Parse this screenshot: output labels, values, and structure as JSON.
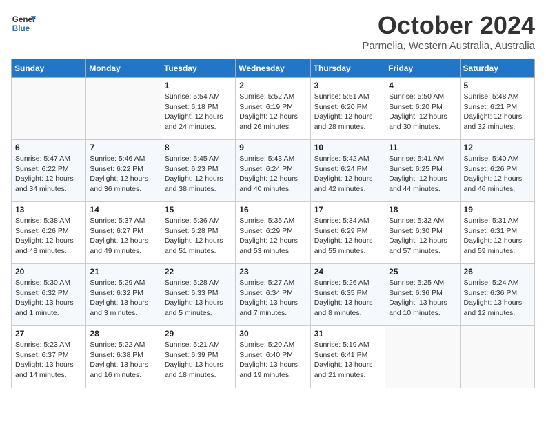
{
  "logo": {
    "line1": "General",
    "line2": "Blue"
  },
  "title": "October 2024",
  "subtitle": "Parmelia, Western Australia, Australia",
  "headers": [
    "Sunday",
    "Monday",
    "Tuesday",
    "Wednesday",
    "Thursday",
    "Friday",
    "Saturday"
  ],
  "weeks": [
    [
      {
        "day": "",
        "info": ""
      },
      {
        "day": "",
        "info": ""
      },
      {
        "day": "1",
        "info": "Sunrise: 5:54 AM\nSunset: 6:18 PM\nDaylight: 12 hours\nand 24 minutes."
      },
      {
        "day": "2",
        "info": "Sunrise: 5:52 AM\nSunset: 6:19 PM\nDaylight: 12 hours\nand 26 minutes."
      },
      {
        "day": "3",
        "info": "Sunrise: 5:51 AM\nSunset: 6:20 PM\nDaylight: 12 hours\nand 28 minutes."
      },
      {
        "day": "4",
        "info": "Sunrise: 5:50 AM\nSunset: 6:20 PM\nDaylight: 12 hours\nand 30 minutes."
      },
      {
        "day": "5",
        "info": "Sunrise: 5:48 AM\nSunset: 6:21 PM\nDaylight: 12 hours\nand 32 minutes."
      }
    ],
    [
      {
        "day": "6",
        "info": "Sunrise: 5:47 AM\nSunset: 6:22 PM\nDaylight: 12 hours\nand 34 minutes."
      },
      {
        "day": "7",
        "info": "Sunrise: 5:46 AM\nSunset: 6:22 PM\nDaylight: 12 hours\nand 36 minutes."
      },
      {
        "day": "8",
        "info": "Sunrise: 5:45 AM\nSunset: 6:23 PM\nDaylight: 12 hours\nand 38 minutes."
      },
      {
        "day": "9",
        "info": "Sunrise: 5:43 AM\nSunset: 6:24 PM\nDaylight: 12 hours\nand 40 minutes."
      },
      {
        "day": "10",
        "info": "Sunrise: 5:42 AM\nSunset: 6:24 PM\nDaylight: 12 hours\nand 42 minutes."
      },
      {
        "day": "11",
        "info": "Sunrise: 5:41 AM\nSunset: 6:25 PM\nDaylight: 12 hours\nand 44 minutes."
      },
      {
        "day": "12",
        "info": "Sunrise: 5:40 AM\nSunset: 6:26 PM\nDaylight: 12 hours\nand 46 minutes."
      }
    ],
    [
      {
        "day": "13",
        "info": "Sunrise: 5:38 AM\nSunset: 6:26 PM\nDaylight: 12 hours\nand 48 minutes."
      },
      {
        "day": "14",
        "info": "Sunrise: 5:37 AM\nSunset: 6:27 PM\nDaylight: 12 hours\nand 49 minutes."
      },
      {
        "day": "15",
        "info": "Sunrise: 5:36 AM\nSunset: 6:28 PM\nDaylight: 12 hours\nand 51 minutes."
      },
      {
        "day": "16",
        "info": "Sunrise: 5:35 AM\nSunset: 6:29 PM\nDaylight: 12 hours\nand 53 minutes."
      },
      {
        "day": "17",
        "info": "Sunrise: 5:34 AM\nSunset: 6:29 PM\nDaylight: 12 hours\nand 55 minutes."
      },
      {
        "day": "18",
        "info": "Sunrise: 5:32 AM\nSunset: 6:30 PM\nDaylight: 12 hours\nand 57 minutes."
      },
      {
        "day": "19",
        "info": "Sunrise: 5:31 AM\nSunset: 6:31 PM\nDaylight: 12 hours\nand 59 minutes."
      }
    ],
    [
      {
        "day": "20",
        "info": "Sunrise: 5:30 AM\nSunset: 6:32 PM\nDaylight: 13 hours\nand 1 minute."
      },
      {
        "day": "21",
        "info": "Sunrise: 5:29 AM\nSunset: 6:32 PM\nDaylight: 13 hours\nand 3 minutes."
      },
      {
        "day": "22",
        "info": "Sunrise: 5:28 AM\nSunset: 6:33 PM\nDaylight: 13 hours\nand 5 minutes."
      },
      {
        "day": "23",
        "info": "Sunrise: 5:27 AM\nSunset: 6:34 PM\nDaylight: 13 hours\nand 7 minutes."
      },
      {
        "day": "24",
        "info": "Sunrise: 5:26 AM\nSunset: 6:35 PM\nDaylight: 13 hours\nand 8 minutes."
      },
      {
        "day": "25",
        "info": "Sunrise: 5:25 AM\nSunset: 6:36 PM\nDaylight: 13 hours\nand 10 minutes."
      },
      {
        "day": "26",
        "info": "Sunrise: 5:24 AM\nSunset: 6:36 PM\nDaylight: 13 hours\nand 12 minutes."
      }
    ],
    [
      {
        "day": "27",
        "info": "Sunrise: 5:23 AM\nSunset: 6:37 PM\nDaylight: 13 hours\nand 14 minutes."
      },
      {
        "day": "28",
        "info": "Sunrise: 5:22 AM\nSunset: 6:38 PM\nDaylight: 13 hours\nand 16 minutes."
      },
      {
        "day": "29",
        "info": "Sunrise: 5:21 AM\nSunset: 6:39 PM\nDaylight: 13 hours\nand 18 minutes."
      },
      {
        "day": "30",
        "info": "Sunrise: 5:20 AM\nSunset: 6:40 PM\nDaylight: 13 hours\nand 19 minutes."
      },
      {
        "day": "31",
        "info": "Sunrise: 5:19 AM\nSunset: 6:41 PM\nDaylight: 13 hours\nand 21 minutes."
      },
      {
        "day": "",
        "info": ""
      },
      {
        "day": "",
        "info": ""
      }
    ]
  ]
}
